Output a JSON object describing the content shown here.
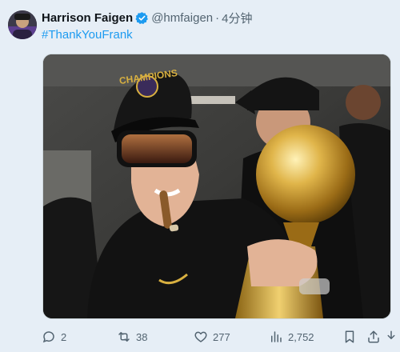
{
  "tweet": {
    "author_name": "Harrison Faigen",
    "handle": "@hmfaigen",
    "separator": "·",
    "timestamp": "4分钟",
    "text": "#ThankYouFrank"
  },
  "media": {
    "cap_text": "CHAMPIONS"
  },
  "actions": {
    "replies": "2",
    "reposts": "38",
    "likes": "277",
    "views": "2,752"
  },
  "icons": {
    "verified": "verified-badge-icon",
    "reply": "speech-bubble-icon",
    "repost": "repost-arrows-icon",
    "like": "heart-icon",
    "views": "bar-chart-icon",
    "bookmark": "bookmark-icon",
    "share": "share-upload-icon"
  },
  "colors": {
    "accent": "#1d9bf0",
    "text": "#0f1419",
    "muted": "#536471"
  }
}
